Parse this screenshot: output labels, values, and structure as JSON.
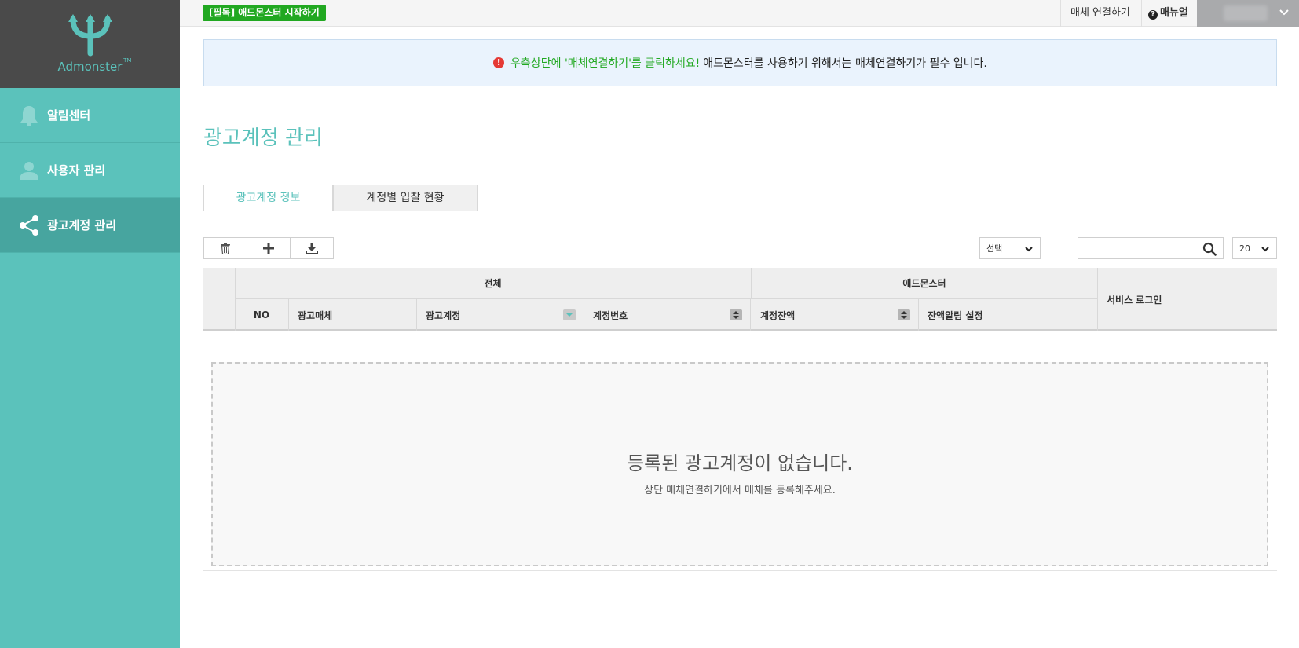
{
  "brand": {
    "name": "Admonster",
    "tm": "TM",
    "color": "#5bc2bb"
  },
  "sidebar": {
    "items": [
      {
        "label": "알림센터",
        "icon": "bell-icon"
      },
      {
        "label": "사용자 관리",
        "icon": "user-icon"
      },
      {
        "label": "광고계정 관리",
        "icon": "share-icon",
        "active": true
      }
    ]
  },
  "topbar": {
    "start_badge": "[필독] 애드몬스터 시작하기",
    "connect_label": "매체 연결하기",
    "manual_label": "매뉴얼"
  },
  "notice": {
    "highlight": "우측상단에 '매체연결하기'를 클릭하세요!",
    "message": "애드몬스터를 사용하기 위해서는 매체연결하기가 필수 입니다."
  },
  "page": {
    "title": "광고계정 관리"
  },
  "tabs": [
    {
      "label": "광고계정 정보",
      "active": true
    },
    {
      "label": "계정별 입찰 현황",
      "active": false
    }
  ],
  "toolbar": {
    "filter_select": "선택",
    "search_value": "",
    "page_size": "20"
  },
  "table": {
    "group_all": "전체",
    "group_admonster": "애드몬스터",
    "service_login": "서비스 로그인",
    "columns": [
      "NO",
      "광고매체",
      "광고계정",
      "계정번호",
      "계정잔액",
      "잔액알림 설정"
    ]
  },
  "empty_state": {
    "title": "등록된 광고계정이 없습니다.",
    "subtitle": "상단 매체연결하기에서 매체를 등록해주세요."
  }
}
